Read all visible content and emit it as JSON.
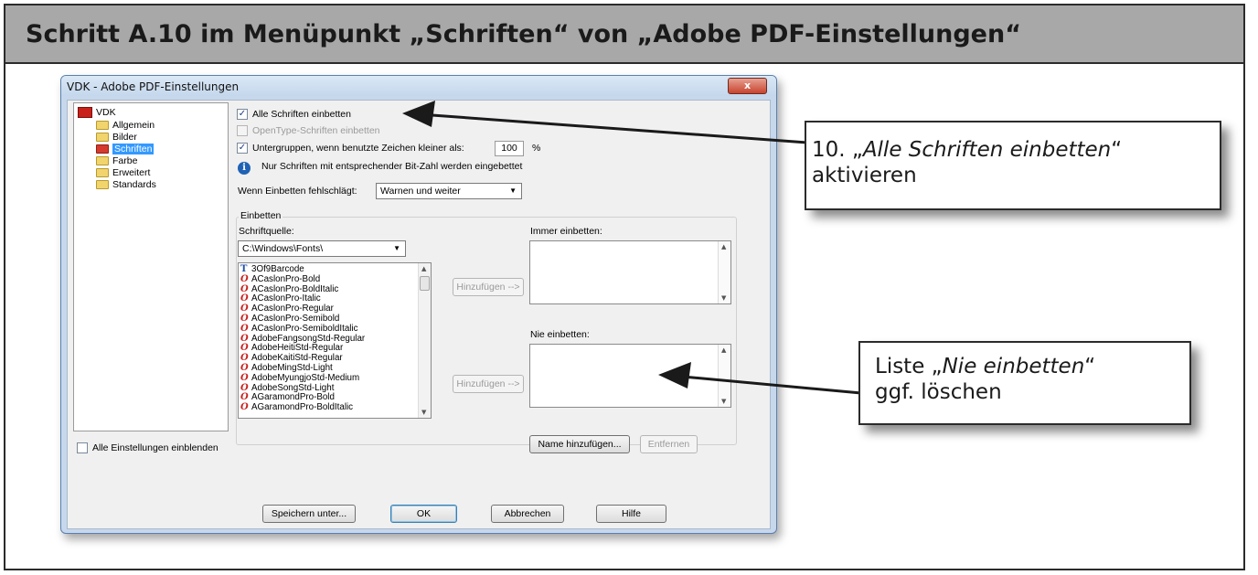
{
  "header": {
    "title": "Schritt A.10 im Menüpunkt „Schriften“ von „Adobe PDF-Einstellungen“"
  },
  "dialog": {
    "title": "VDK - Adobe PDF-Einstellungen",
    "close_label": "x",
    "tree": [
      {
        "label": "VDK",
        "icon": "pdf-settings-icon"
      },
      {
        "label": "Allgemein",
        "icon": "folder-icon"
      },
      {
        "label": "Bilder",
        "icon": "folder-icon"
      },
      {
        "label": "Schriften",
        "icon": "folder-open-icon",
        "selected": true
      },
      {
        "label": "Farbe",
        "icon": "folder-icon"
      },
      {
        "label": "Erweitert",
        "icon": "folder-icon"
      },
      {
        "label": "Standards",
        "icon": "folder-icon"
      }
    ],
    "show_all_label": "Alle Einstellungen einblenden",
    "embed_all_label": "Alle Schriften einbetten",
    "embed_all_checked": true,
    "opentype_label": "OpenType-Schriften einbetten",
    "opentype_checked": false,
    "subset_label": "Untergruppen, wenn benutzte Zeichen kleiner als:",
    "subset_checked": true,
    "subset_value": "100",
    "subset_unit": "%",
    "info_text": "Nur Schriften mit entsprechender Bit-Zahl werden eingebettet",
    "fail_label": "Wenn Einbetten fehlschlägt:",
    "fail_value": "Warnen und weiter",
    "group_label": "Einbetten",
    "source_label": "Schriftquelle:",
    "source_value": "C:\\Windows\\Fonts\\",
    "fonts": [
      {
        "name": "3Of9Barcode",
        "type": "truetype"
      },
      {
        "name": "ACaslonPro-Bold",
        "type": "opentype"
      },
      {
        "name": "ACaslonPro-BoldItalic",
        "type": "opentype"
      },
      {
        "name": "ACaslonPro-Italic",
        "type": "opentype"
      },
      {
        "name": "ACaslonPro-Regular",
        "type": "opentype"
      },
      {
        "name": "ACaslonPro-Semibold",
        "type": "opentype"
      },
      {
        "name": "ACaslonPro-SemiboldItalic",
        "type": "opentype"
      },
      {
        "name": "AdobeFangsongStd-Regular",
        "type": "opentype"
      },
      {
        "name": "AdobeHeitiStd-Regular",
        "type": "opentype"
      },
      {
        "name": "AdobeKaitiStd-Regular",
        "type": "opentype"
      },
      {
        "name": "AdobeMingStd-Light",
        "type": "opentype"
      },
      {
        "name": "AdobeMyungjoStd-Medium",
        "type": "opentype"
      },
      {
        "name": "AdobeSongStd-Light",
        "type": "opentype"
      },
      {
        "name": "AGaramondPro-Bold",
        "type": "opentype"
      },
      {
        "name": "AGaramondPro-BoldItalic",
        "type": "opentype"
      }
    ],
    "add_label": "Hinzufügen -->",
    "always_label": "Immer einbetten:",
    "never_label": "Nie einbetten:",
    "add_name_label": "Name hinzufügen...",
    "remove_label": "Entfernen",
    "save_as_label": "Speichern unter...",
    "ok_label": "OK",
    "cancel_label": "Abbrechen",
    "help_label": "Hilfe"
  },
  "callouts": {
    "one": {
      "prefix": "10. „",
      "italic": "Alle Schriften einbetten",
      "suffix": "“",
      "line2": "aktivieren"
    },
    "two": {
      "prefix": "Liste „",
      "italic": "Nie einbetten",
      "suffix": "“",
      "line2": "ggf. löschen"
    }
  }
}
